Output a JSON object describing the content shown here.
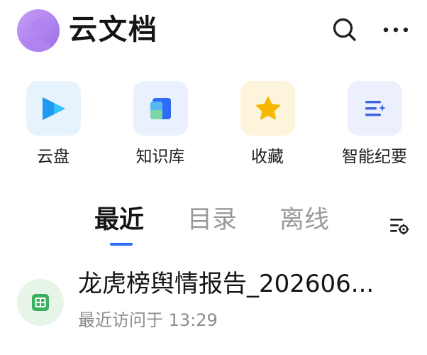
{
  "header": {
    "title": "云文档",
    "avatar_icon": "user-avatar-icon",
    "search_icon": "search-icon",
    "more_icon": "more-icon"
  },
  "quick_entries": [
    {
      "label": "云盘",
      "icon": "cloud-drive-icon",
      "color": "#2c6cf6"
    },
    {
      "label": "知识库",
      "icon": "knowledge-base-icon",
      "color": "#2c6cf6"
    },
    {
      "label": "收藏",
      "icon": "star-icon",
      "color": "#f5b800"
    },
    {
      "label": "智能纪要",
      "icon": "smart-notes-icon",
      "color": "#3a63e0"
    }
  ],
  "tabs": [
    {
      "label": "最近",
      "active": true
    },
    {
      "label": "目录",
      "active": false
    },
    {
      "label": "离线",
      "active": false
    }
  ],
  "filter_icon": "filter-settings-icon",
  "recent_files": [
    {
      "title": "龙虎榜舆情报告_202606...",
      "meta": "最近访问于 13:29",
      "icon": "spreadsheet-icon",
      "icon_color": "#3cb061"
    }
  ],
  "colors": {
    "accent": "#2c6cf6",
    "text_primary": "#141414",
    "text_secondary": "#8c8c8c"
  }
}
